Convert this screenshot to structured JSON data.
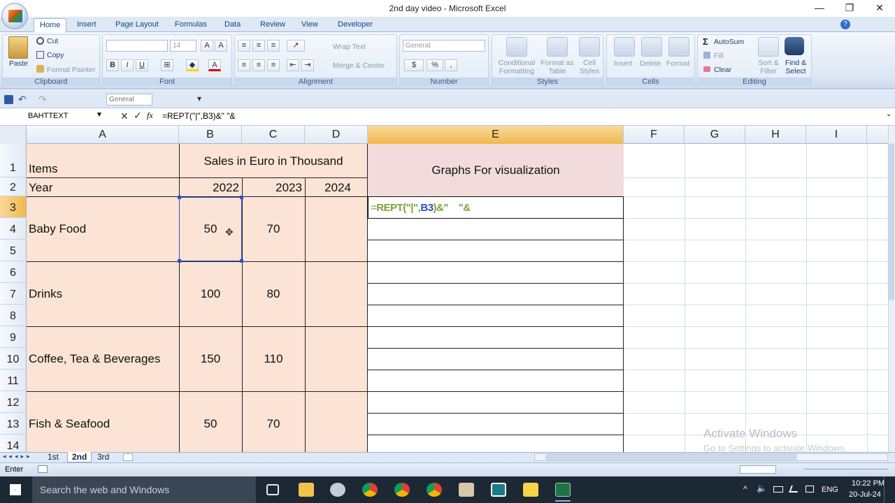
{
  "window": {
    "title": "2nd day video - Microsoft Excel",
    "minimize": "—",
    "restore": "❐",
    "close": "✕"
  },
  "ribbon_tabs": [
    "Home",
    "Insert",
    "Page Layout",
    "Formulas",
    "Data",
    "Review",
    "View",
    "Developer"
  ],
  "clipboard": {
    "paste": "Paste",
    "cut": "Cut",
    "copy": "Copy",
    "format_painter": "Format Painter",
    "label": "Clipboard"
  },
  "font": {
    "size": "14",
    "label": "Font",
    "bold": "B",
    "italic": "I",
    "underline": "U"
  },
  "alignment": {
    "wrap": "Wrap Text",
    "merge": "Merge & Center",
    "label": "Alignment"
  },
  "number": {
    "format": "General",
    "currency": "$",
    "percent": "%",
    "comma": ",",
    "label": "Number"
  },
  "styles": {
    "conditional": "Conditional Formatting",
    "format_table": "Format as Table",
    "cell_styles": "Cell Styles",
    "label": "Styles"
  },
  "cells": {
    "insert": "Insert",
    "delete": "Delete",
    "format": "Format",
    "label": "Cells"
  },
  "editing": {
    "autosum": "AutoSum",
    "fill": "Fill",
    "clear": "Clear",
    "sort": "Sort & Filter",
    "find": "Find & Select",
    "label": "Editing"
  },
  "qat": {
    "format": "General"
  },
  "formula_bar": {
    "name_box": "BAHTTEXT",
    "formula": "=REPT(\"|\",B3)&\"  \"&",
    "fx": "fx"
  },
  "columns": [
    "A",
    "B",
    "C",
    "D",
    "E",
    "F",
    "G",
    "H",
    "I"
  ],
  "rows": [
    "1",
    "2",
    "3",
    "4",
    "5",
    "6",
    "7",
    "8",
    "9",
    "10",
    "11",
    "12",
    "13",
    "14"
  ],
  "sheet": {
    "a1": "Items",
    "a2": "Year",
    "b1": "Sales in Euro in Thousand",
    "e1": "Graphs For visualization",
    "b2": "2022",
    "c2": "2023",
    "d2": "2024",
    "items": [
      {
        "name": "Baby Food",
        "y2022": "50",
        "y2023": "70"
      },
      {
        "name": "Drinks",
        "y2022": "100",
        "y2023": "80"
      },
      {
        "name": "Coffee, Tea & Beverages",
        "y2022": "150",
        "y2023": "110"
      },
      {
        "name": "Fish & Seafood",
        "y2022": "50",
        "y2023": "70"
      }
    ],
    "editing_formula": {
      "eq": "=",
      "fn": "REPT(\"|\",",
      "ref": "B3",
      "rest": ")&\"    \"&"
    }
  },
  "watermark": {
    "line1": "Activate Windows",
    "line2": "Go to Settings to activate Windows."
  },
  "sheet_tabs": [
    "1st",
    "2nd",
    "3rd"
  ],
  "active_sheet": "2nd",
  "status": {
    "mode": "Enter"
  },
  "taskbar": {
    "search": "Search the web and Windows",
    "lang": "ENG",
    "time": "10:22 PM",
    "date": "20-Jul-24"
  }
}
